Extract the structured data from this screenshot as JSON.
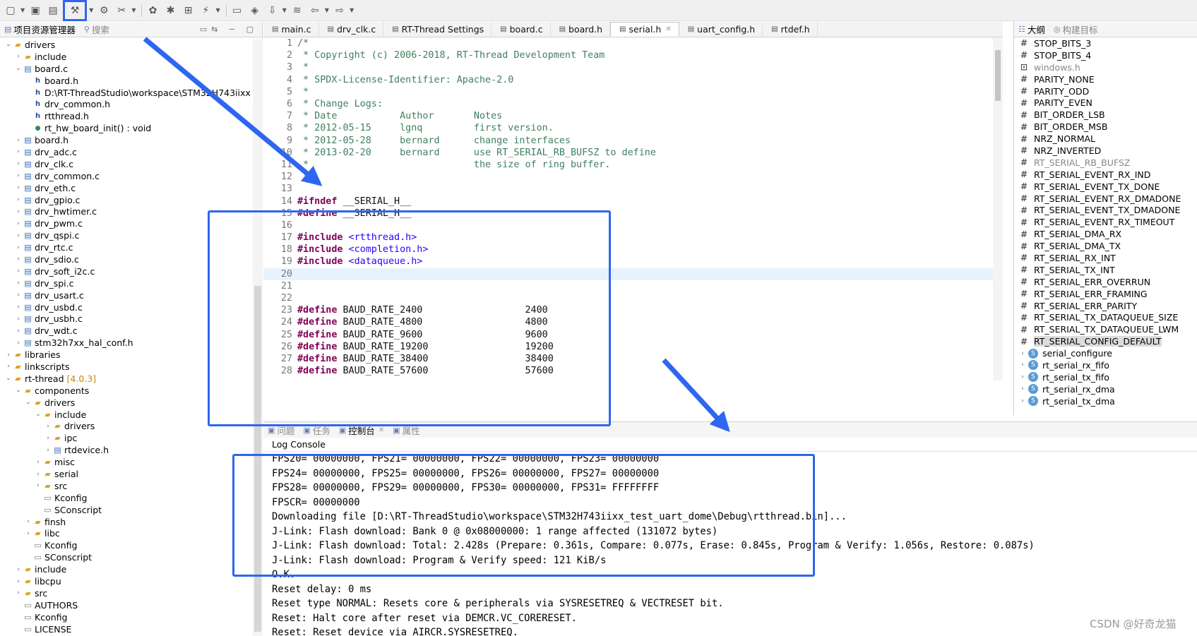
{
  "toolbar": {
    "icons": [
      "new-file-icon",
      "save-icon",
      "save-all-icon",
      "build-icon",
      "debug-config-icon",
      "settings-icon",
      "download-icon",
      "debug-icon",
      "run-icon",
      "open-icon",
      "terminal-icon",
      "layers-icon",
      "back-icon",
      "forward-icon"
    ]
  },
  "project_explorer": {
    "tabs": [
      {
        "label": "项目资源管理器",
        "active": true
      },
      {
        "label": "搜索",
        "active": false
      }
    ],
    "tree": [
      {
        "label": "drivers",
        "indent": 1,
        "icon": "folder",
        "toggle": "v"
      },
      {
        "label": "include",
        "indent": 2,
        "icon": "folder",
        "toggle": ">"
      },
      {
        "label": "board.c",
        "indent": 2,
        "icon": "cfile",
        "toggle": "v"
      },
      {
        "label": "board.h",
        "indent": 3,
        "icon": "hfile",
        "toggle": ""
      },
      {
        "label": "D:\\RT-ThreadStudio\\workspace\\STM32H743iixx",
        "indent": 3,
        "icon": "hfile",
        "toggle": ""
      },
      {
        "label": "drv_common.h",
        "indent": 3,
        "icon": "hfile",
        "toggle": ""
      },
      {
        "label": "rtthread.h",
        "indent": 3,
        "icon": "hfile",
        "toggle": ""
      },
      {
        "label": "rt_hw_board_init() : void",
        "indent": 3,
        "icon": "fn",
        "toggle": ""
      },
      {
        "label": "board.h",
        "indent": 2,
        "icon": "cfile",
        "toggle": ">"
      },
      {
        "label": "drv_adc.c",
        "indent": 2,
        "icon": "cfile",
        "toggle": ">"
      },
      {
        "label": "drv_clk.c",
        "indent": 2,
        "icon": "cfile",
        "toggle": ">"
      },
      {
        "label": "drv_common.c",
        "indent": 2,
        "icon": "cfile",
        "toggle": ">"
      },
      {
        "label": "drv_eth.c",
        "indent": 2,
        "icon": "cfile",
        "toggle": ">"
      },
      {
        "label": "drv_gpio.c",
        "indent": 2,
        "icon": "cfile",
        "toggle": ">"
      },
      {
        "label": "drv_hwtimer.c",
        "indent": 2,
        "icon": "cfile",
        "toggle": ">"
      },
      {
        "label": "drv_pwm.c",
        "indent": 2,
        "icon": "cfile",
        "toggle": ">"
      },
      {
        "label": "drv_qspi.c",
        "indent": 2,
        "icon": "cfile",
        "toggle": ">"
      },
      {
        "label": "drv_rtc.c",
        "indent": 2,
        "icon": "cfile",
        "toggle": ">"
      },
      {
        "label": "drv_sdio.c",
        "indent": 2,
        "icon": "cfile",
        "toggle": ">"
      },
      {
        "label": "drv_soft_i2c.c",
        "indent": 2,
        "icon": "cfile",
        "toggle": ">"
      },
      {
        "label": "drv_spi.c",
        "indent": 2,
        "icon": "cfile",
        "toggle": ">"
      },
      {
        "label": "drv_usart.c",
        "indent": 2,
        "icon": "cfile",
        "toggle": ">"
      },
      {
        "label": "drv_usbd.c",
        "indent": 2,
        "icon": "cfile",
        "toggle": ">"
      },
      {
        "label": "drv_usbh.c",
        "indent": 2,
        "icon": "cfile",
        "toggle": ">"
      },
      {
        "label": "drv_wdt.c",
        "indent": 2,
        "icon": "cfile",
        "toggle": ">"
      },
      {
        "label": "stm32h7xx_hal_conf.h",
        "indent": 2,
        "icon": "cfile",
        "toggle": ">"
      },
      {
        "label": "libraries",
        "indent": 1,
        "icon": "folder",
        "toggle": ">"
      },
      {
        "label": "linkscripts",
        "indent": 1,
        "icon": "folder",
        "toggle": ">"
      },
      {
        "label": "rt-thread",
        "version": "[4.0.3]",
        "indent": 1,
        "icon": "folder",
        "toggle": "v"
      },
      {
        "label": "components",
        "indent": 2,
        "icon": "folder",
        "toggle": "v"
      },
      {
        "label": "drivers",
        "indent": 3,
        "icon": "folder",
        "toggle": "v"
      },
      {
        "label": "include",
        "indent": 4,
        "icon": "folder",
        "toggle": "v"
      },
      {
        "label": "drivers",
        "indent": 5,
        "icon": "folder",
        "toggle": ">"
      },
      {
        "label": "ipc",
        "indent": 5,
        "icon": "folder",
        "toggle": ">"
      },
      {
        "label": "rtdevice.h",
        "indent": 5,
        "icon": "cfile",
        "toggle": ">"
      },
      {
        "label": "misc",
        "indent": 4,
        "icon": "folder",
        "toggle": ">"
      },
      {
        "label": "serial",
        "indent": 4,
        "icon": "folder",
        "toggle": ">"
      },
      {
        "label": "src",
        "indent": 4,
        "icon": "folder",
        "toggle": ">"
      },
      {
        "label": "Kconfig",
        "indent": 4,
        "icon": "txt",
        "toggle": ""
      },
      {
        "label": "SConscript",
        "indent": 4,
        "icon": "txt",
        "toggle": ""
      },
      {
        "label": "finsh",
        "indent": 3,
        "icon": "folder",
        "toggle": ">"
      },
      {
        "label": "libc",
        "indent": 3,
        "icon": "folder",
        "toggle": ">"
      },
      {
        "label": "Kconfig",
        "indent": 3,
        "icon": "txt",
        "toggle": ""
      },
      {
        "label": "SConscript",
        "indent": 3,
        "icon": "txt",
        "toggle": ""
      },
      {
        "label": "include",
        "indent": 2,
        "icon": "folder",
        "toggle": ">"
      },
      {
        "label": "libcpu",
        "indent": 2,
        "icon": "folder",
        "toggle": ">"
      },
      {
        "label": "src",
        "indent": 2,
        "icon": "folder",
        "toggle": ">"
      },
      {
        "label": "AUTHORS",
        "indent": 2,
        "icon": "txt",
        "toggle": ""
      },
      {
        "label": "Kconfig",
        "indent": 2,
        "icon": "txt",
        "toggle": ""
      },
      {
        "label": "LICENSE",
        "indent": 2,
        "icon": "txt",
        "toggle": ""
      }
    ]
  },
  "editor": {
    "tabs": [
      {
        "label": "main.c",
        "active": false
      },
      {
        "label": "drv_clk.c",
        "active": false
      },
      {
        "label": "RT-Thread Settings",
        "active": false
      },
      {
        "label": "board.c",
        "active": false
      },
      {
        "label": "board.h",
        "active": false
      },
      {
        "label": "serial.h",
        "active": true
      },
      {
        "label": "uart_config.h",
        "active": false
      },
      {
        "label": "rtdef.h",
        "active": false
      }
    ],
    "current_line": 20,
    "lines": [
      {
        "n": "1",
        "text": "/*",
        "type": "comment"
      },
      {
        "n": "2",
        "text": " * Copyright (c) 2006-2018, RT-Thread Development Team",
        "type": "comment"
      },
      {
        "n": "3",
        "text": " *",
        "type": "comment"
      },
      {
        "n": "4",
        "text": " * SPDX-License-Identifier: Apache-2.0",
        "type": "comment"
      },
      {
        "n": "5",
        "text": " *",
        "type": "comment"
      },
      {
        "n": "6",
        "text": " * Change Logs:",
        "type": "comment"
      },
      {
        "n": "7",
        "text": " * Date           Author       Notes",
        "type": "comment"
      },
      {
        "n": "8",
        "text": " * 2012-05-15     lgnq         first version.",
        "type": "comment"
      },
      {
        "n": "9",
        "text": " * 2012-05-28     bernard      change interfaces",
        "type": "comment"
      },
      {
        "n": "10",
        "text": " * 2013-02-20     bernard      use RT_SERIAL_RB_BUFSZ to define",
        "type": "comment"
      },
      {
        "n": "11",
        "text": " *                             the size of ring buffer.",
        "type": "comment"
      },
      {
        "n": "12",
        "text": " */",
        "type": "comment"
      },
      {
        "n": "13",
        "text": "",
        "type": "plain"
      },
      {
        "n": "14",
        "kw": "#ifndef",
        "rest": " __SERIAL_H__",
        "type": "pp"
      },
      {
        "n": "15",
        "kw": "#define",
        "rest": " __SERIAL_H__",
        "type": "pp"
      },
      {
        "n": "16",
        "text": "",
        "type": "plain"
      },
      {
        "n": "17",
        "kw": "#include",
        "inc": " <rtthread.h>",
        "type": "include"
      },
      {
        "n": "18",
        "kw": "#include",
        "inc": " <completion.h>",
        "type": "include"
      },
      {
        "n": "19",
        "kw": "#include",
        "inc": " <dataqueue.h>",
        "type": "include"
      },
      {
        "n": "20",
        "text": "",
        "type": "plain"
      },
      {
        "n": "21",
        "text": "",
        "type": "plain"
      },
      {
        "n": "22",
        "text": "",
        "type": "plain"
      },
      {
        "n": "23",
        "kw": "#define",
        "rest": " BAUD_RATE_2400                  2400",
        "type": "pp"
      },
      {
        "n": "24",
        "kw": "#define",
        "rest": " BAUD_RATE_4800                  4800",
        "type": "pp"
      },
      {
        "n": "25",
        "kw": "#define",
        "rest": " BAUD_RATE_9600                  9600",
        "type": "pp"
      },
      {
        "n": "26",
        "kw": "#define",
        "rest": " BAUD_RATE_19200                 19200",
        "type": "pp"
      },
      {
        "n": "27",
        "kw": "#define",
        "rest": " BAUD_RATE_38400                 38400",
        "type": "pp"
      },
      {
        "n": "28",
        "kw": "#define",
        "rest": " BAUD_RATE_57600                 57600",
        "type": "pp"
      }
    ]
  },
  "outline": {
    "tabs": [
      {
        "label": "大纲",
        "active": true
      },
      {
        "label": "构建目标",
        "active": false
      }
    ],
    "items": [
      {
        "label": "STOP_BITS_3",
        "kind": "macro"
      },
      {
        "label": "STOP_BITS_4",
        "kind": "macro"
      },
      {
        "label": "windows.h",
        "kind": "include"
      },
      {
        "label": "PARITY_NONE",
        "kind": "macro"
      },
      {
        "label": "PARITY_ODD",
        "kind": "macro"
      },
      {
        "label": "PARITY_EVEN",
        "kind": "macro"
      },
      {
        "label": "BIT_ORDER_LSB",
        "kind": "macro"
      },
      {
        "label": "BIT_ORDER_MSB",
        "kind": "macro"
      },
      {
        "label": "NRZ_NORMAL",
        "kind": "macro"
      },
      {
        "label": "NRZ_INVERTED",
        "kind": "macro"
      },
      {
        "label": "RT_SERIAL_RB_BUFSZ",
        "kind": "macro-grey"
      },
      {
        "label": "RT_SERIAL_EVENT_RX_IND",
        "kind": "macro"
      },
      {
        "label": "RT_SERIAL_EVENT_TX_DONE",
        "kind": "macro"
      },
      {
        "label": "RT_SERIAL_EVENT_RX_DMADONE",
        "kind": "macro"
      },
      {
        "label": "RT_SERIAL_EVENT_TX_DMADONE",
        "kind": "macro"
      },
      {
        "label": "RT_SERIAL_EVENT_RX_TIMEOUT",
        "kind": "macro"
      },
      {
        "label": "RT_SERIAL_DMA_RX",
        "kind": "macro"
      },
      {
        "label": "RT_SERIAL_DMA_TX",
        "kind": "macro"
      },
      {
        "label": "RT_SERIAL_RX_INT",
        "kind": "macro"
      },
      {
        "label": "RT_SERIAL_TX_INT",
        "kind": "macro"
      },
      {
        "label": "RT_SERIAL_ERR_OVERRUN",
        "kind": "macro"
      },
      {
        "label": "RT_SERIAL_ERR_FRAMING",
        "kind": "macro"
      },
      {
        "label": "RT_SERIAL_ERR_PARITY",
        "kind": "macro"
      },
      {
        "label": "RT_SERIAL_TX_DATAQUEUE_SIZE",
        "kind": "macro"
      },
      {
        "label": "RT_SERIAL_TX_DATAQUEUE_LWM",
        "kind": "macro"
      },
      {
        "label": "RT_SERIAL_CONFIG_DEFAULT",
        "kind": "macro-selected"
      },
      {
        "label": "serial_configure",
        "kind": "struct"
      },
      {
        "label": "rt_serial_rx_fifo",
        "kind": "struct"
      },
      {
        "label": "rt_serial_tx_fifo",
        "kind": "struct"
      },
      {
        "label": "rt_serial_rx_dma",
        "kind": "struct"
      },
      {
        "label": "rt_serial_tx_dma",
        "kind": "struct"
      }
    ]
  },
  "console": {
    "tabs": [
      {
        "label": "问题",
        "active": false
      },
      {
        "label": "任务",
        "active": false
      },
      {
        "label": "控制台",
        "active": true
      },
      {
        "label": "属性",
        "active": false
      }
    ],
    "title": "Log Console",
    "lines": [
      "FPS20= 00000000, FPS21= 00000000, FPS22= 00000000, FPS23= 00000000",
      "FPS24= 00000000, FPS25= 00000000, FPS26= 00000000, FPS27= 00000000",
      "FPS28= 00000000, FPS29= 00000000, FPS30= 00000000, FPS31= FFFFFFFF",
      "FPSCR= 00000000",
      "Downloading file [D:\\RT-ThreadStudio\\workspace\\STM32H743iixx_test_uart_dome\\Debug\\rtthread.bin]...",
      "J-Link: Flash download: Bank 0 @ 0x08000000: 1 range affected (131072 bytes)",
      "J-Link: Flash download: Total: 2.428s (Prepare: 0.361s, Compare: 0.077s, Erase: 0.845s, Program & Verify: 1.056s, Restore: 0.087s)",
      "J-Link: Flash download: Program & Verify speed: 121 KiB/s",
      "O.K.",
      "Reset delay: 0 ms",
      "Reset type NORMAL: Resets core & peripherals via SYSRESETREQ & VECTRESET bit.",
      "Reset: Halt core after reset via DEMCR.VC_CORERESET.",
      "Reset: Reset device via AIRCR.SYSRESETREQ."
    ]
  },
  "annotations": {
    "color": "#2f66f0"
  },
  "watermark": "CSDN @好奇龙猫"
}
